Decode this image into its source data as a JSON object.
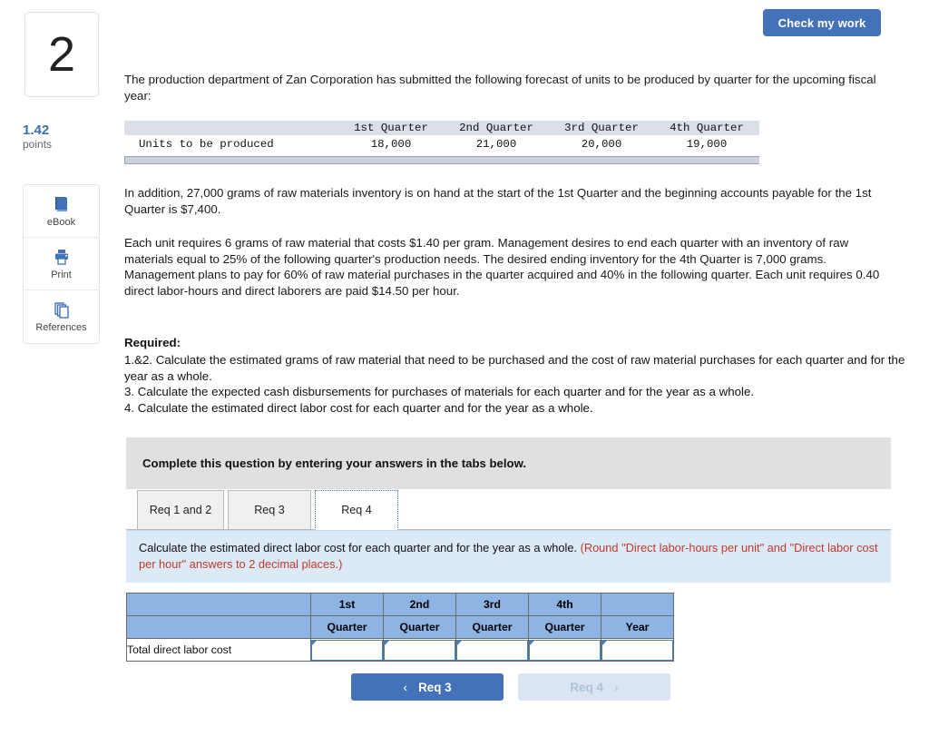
{
  "header": {
    "check_work_label": "Check my work"
  },
  "rail": {
    "question_number": "2",
    "points_value": "1.42",
    "points_label": "points",
    "tools": [
      {
        "icon": "ebook-icon",
        "label": "eBook"
      },
      {
        "icon": "printer-icon",
        "label": "Print"
      },
      {
        "icon": "references-icon",
        "label": "References"
      }
    ]
  },
  "body": {
    "intro": "The production department of Zan Corporation has submitted the following forecast of units to be produced by quarter for the upcoming fiscal year:",
    "paragraph_inventory": "In addition, 27,000 grams of raw materials inventory is on hand at the start of the 1st Quarter and the beginning accounts payable for the 1st Quarter is $7,400.",
    "paragraph_details": "Each unit requires 6 grams of raw material that costs $1.40 per gram. Management desires to end each quarter with an inventory of raw materials equal to 25% of the following quarter's production needs. The desired ending inventory for the 4th Quarter is 7,000 grams. Management plans to pay for 60% of raw material purchases in the quarter acquired and 40% in the following quarter. Each unit requires 0.40 direct labor-hours and direct laborers are paid $14.50 per hour.",
    "required_heading": "Required:",
    "required_items": [
      "1.&2. Calculate the estimated grams of raw material that need to be purchased and the cost of raw material purchases for each quarter and for the year as a whole.",
      "3. Calculate the expected cash disbursements for purchases of materials for each quarter and for the year as a whole.",
      "4. Calculate the estimated direct labor cost for each quarter and for the year as a whole."
    ]
  },
  "forecast_table": {
    "headers": [
      "",
      "1st Quarter",
      "2nd Quarter",
      "3rd Quarter",
      "4th Quarter"
    ],
    "row_label": "Units to be produced",
    "values": [
      "18,000",
      "21,000",
      "20,000",
      "19,000"
    ]
  },
  "question_panel": {
    "banner": "Complete this question by entering your answers in the tabs below.",
    "tabs": [
      {
        "label": "Req 1 and 2",
        "active": false
      },
      {
        "label": "Req 3",
        "active": false
      },
      {
        "label": "Req 4",
        "active": true
      }
    ],
    "instruction_main": "Calculate the estimated direct labor cost for each quarter and for the year as a whole.",
    "instruction_note": "(Round \"Direct labor-hours per unit\" and \"Direct labor cost per hour\" answers to 2 decimal places.)"
  },
  "answer_table": {
    "header_row_1": [
      "",
      "1st",
      "2nd",
      "3rd",
      "4th",
      ""
    ],
    "header_row_2": [
      "",
      "Quarter",
      "Quarter",
      "Quarter",
      "Quarter",
      "Year"
    ],
    "row_label": "Total direct labor cost",
    "cell_values": [
      "",
      "",
      "",
      "",
      ""
    ],
    "cell_placeholder": ""
  },
  "nav": {
    "prev_label": "Req 3",
    "prev_chevron": "‹",
    "next_label": "Req 4",
    "next_chevron": "›"
  },
  "colors": {
    "accent_blue": "#4472b8",
    "table_header_blue": "#8eb4e3",
    "instruction_bg": "#dceaf7",
    "note_red": "#c0392b",
    "banner_gray": "#e0e0e0"
  }
}
